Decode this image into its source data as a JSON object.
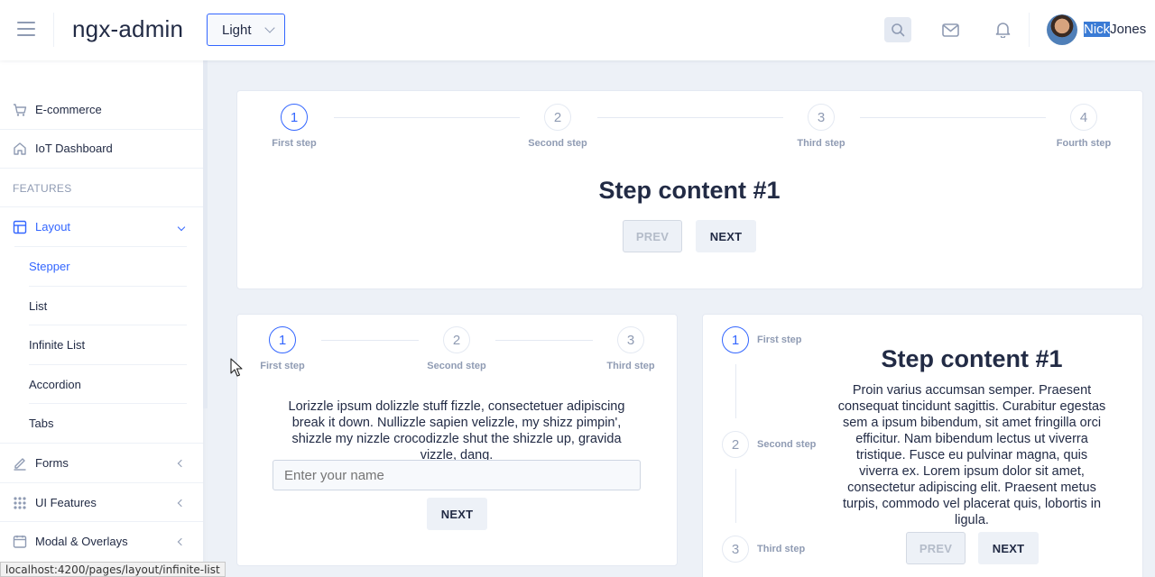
{
  "header": {
    "logo": "ngx-admin",
    "theme_select": "Light",
    "user": {
      "first": "Nick",
      "last": "Jones"
    },
    "icons": [
      "menu-icon",
      "search-icon",
      "mail-icon",
      "bell-icon"
    ]
  },
  "sidebar": {
    "items": [
      {
        "label": "E-commerce",
        "icon": "cart-icon"
      },
      {
        "label": "IoT Dashboard",
        "icon": "home-icon"
      }
    ],
    "section": "FEATURES",
    "layout": {
      "label": "Layout",
      "icon": "layout-icon"
    },
    "layout_sub": [
      "Stepper",
      "List",
      "Infinite List",
      "Accordion",
      "Tabs"
    ],
    "groups": [
      {
        "label": "Forms",
        "icon": "edit-icon"
      },
      {
        "label": "UI Features",
        "icon": "grid-icon"
      },
      {
        "label": "Modal & Overlays",
        "icon": "browser-icon"
      }
    ]
  },
  "stepper_top": {
    "steps": [
      {
        "num": "1",
        "label": "First step"
      },
      {
        "num": "2",
        "label": "Second step"
      },
      {
        "num": "3",
        "label": "Third step"
      },
      {
        "num": "4",
        "label": "Fourth step"
      }
    ],
    "title": "Step content #1",
    "prev": "PREV",
    "next": "NEXT"
  },
  "stepper_form": {
    "steps": [
      {
        "num": "1",
        "label": "First step"
      },
      {
        "num": "2",
        "label": "Second step"
      },
      {
        "num": "3",
        "label": "Third step"
      }
    ],
    "text": "Lorizzle ipsum dolizzle stuff fizzle, consectetuer adipiscing break it down. Nullizzle sapien velizzle, my shizz pimpin', shizzle my nizzle crocodizzle shut the shizzle up, gravida vizzle, dang.",
    "placeholder": "Enter your name",
    "next": "NEXT"
  },
  "stepper_vertical": {
    "steps": [
      {
        "num": "1",
        "label": "First step"
      },
      {
        "num": "2",
        "label": "Second step"
      },
      {
        "num": "3",
        "label": "Third step"
      }
    ],
    "title": "Step content #1",
    "text": "Proin varius accumsan semper. Praesent consequat tincidunt sagittis. Curabitur egestas sem a ipsum bibendum, sit amet fringilla orci efficitur. Nam bibendum lectus ut viverra tristique. Fusce eu pulvinar magna, quis viverra ex. Lorem ipsum dolor sit amet, consectetur adipiscing elit. Praesent metus turpis, commodo vel placerat quis, lobortis in ligula.",
    "prev": "PREV",
    "next": "NEXT"
  },
  "status_bar": "localhost:4200/pages/layout/infinite-list",
  "colors": {
    "primary": "#3366ff",
    "muted": "#8f9bb3",
    "text": "#222b45",
    "background": "#edf1f7"
  }
}
